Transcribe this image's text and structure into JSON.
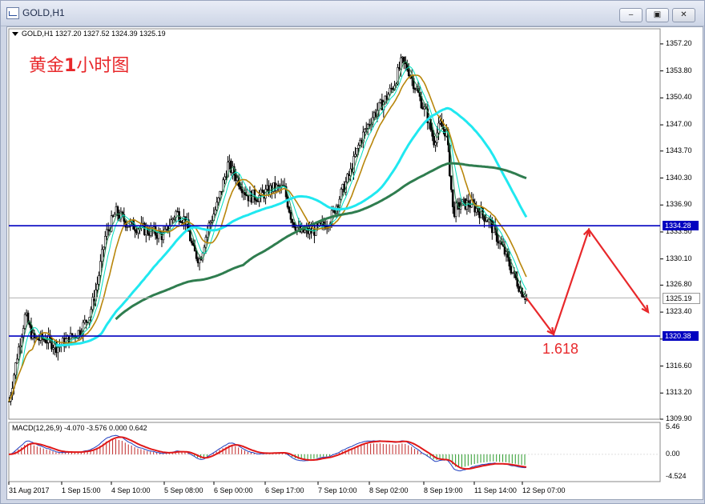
{
  "window": {
    "title": "GOLD,H1",
    "buttons": {
      "minimize": "‒",
      "maximize": "▣",
      "close": "✕"
    }
  },
  "chart": {
    "symbol_line": "GOLD,H1  1327.20 1327.52 1324.39 1325.19",
    "annotation_prefix": "黄金",
    "annotation_bold": "1",
    "annotation_suffix": "小时图",
    "fib_label": "1.618",
    "macd_label": "MACD(12,26,9) -4.070 -3.576 0.000 0.642",
    "price_labels": [
      "1357.20",
      "1353.80",
      "1350.40",
      "1347.00",
      "1343.70",
      "1340.30",
      "1336.90",
      "1333.50",
      "1330.10",
      "1326.80",
      "1323.40",
      "1320.00",
      "1316.60",
      "1313.20",
      "1309.90"
    ],
    "macd_labels": [
      "5.46",
      "0.00",
      "-4.524"
    ],
    "time_labels": [
      "31 Aug 2017",
      "1 Sep 15:00",
      "4 Sep 10:00",
      "5 Sep 08:00",
      "6 Sep 00:00",
      "6 Sep 17:00",
      "7 Sep 10:00",
      "8 Sep 02:00",
      "8 Sep 19:00",
      "11 Sep 14:00",
      "12 Sep 07:00"
    ],
    "hlines": [
      {
        "price": 1334.28,
        "label": "1334.28",
        "color": "#0000c0"
      },
      {
        "price": 1320.38,
        "label": "1320.38",
        "color": "#0000c0"
      }
    ],
    "current_price": {
      "price": 1325.19,
      "label": "1325.19"
    },
    "colors": {
      "bull": "#000000",
      "bear": "#000000",
      "ma_fast": "#2e8b57",
      "ma_slow": "#00e0c0",
      "ma_mid": "#b8860b",
      "ma_cyan": "#20e8f0",
      "ma_long": "#2f7d4f",
      "forecast": "#e8282b",
      "macd_main": "#1f3fbf",
      "macd_signal": "#e01818",
      "hist_pos": "#c02828",
      "hist_neg": "#2a9a2a"
    },
    "price_range": [
      1309.9,
      1358.5
    ],
    "macd_range": [
      -4.524,
      5.46
    ]
  }
}
